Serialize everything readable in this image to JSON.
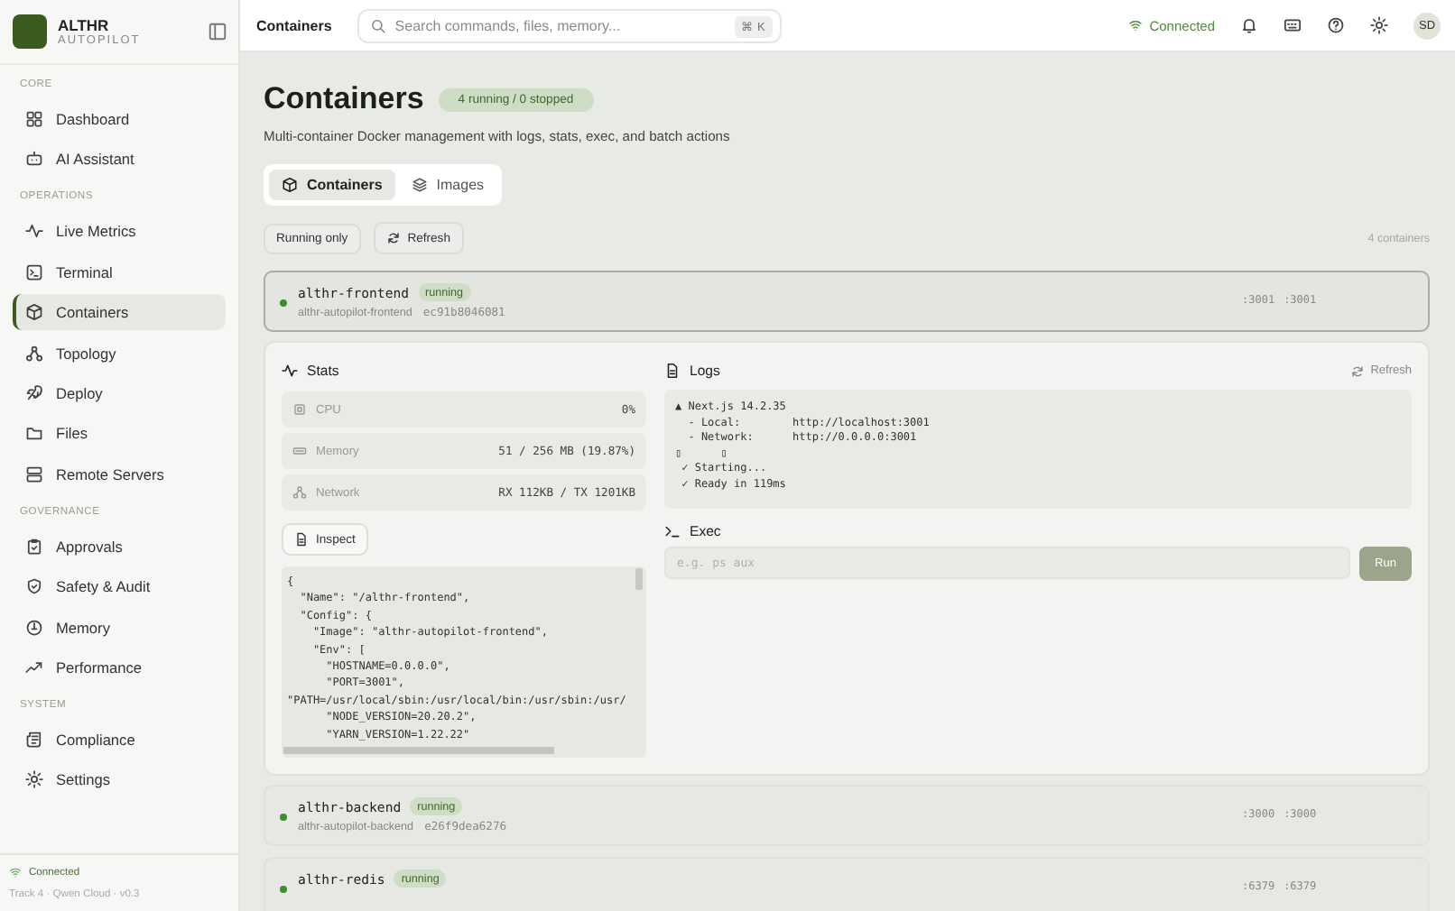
{
  "sidebar": {
    "brand": {
      "name": "ALTHR",
      "subtitle": "AUTOPILOT"
    },
    "sections": [
      {
        "heading": "CORE",
        "items": [
          {
            "label": "Dashboard",
            "selected": false
          },
          {
            "label": "AI Assistant",
            "selected": false
          }
        ]
      },
      {
        "heading": "OPERATIONS",
        "items": [
          {
            "label": "Live Metrics",
            "selected": false
          },
          {
            "label": "Terminal",
            "selected": false
          },
          {
            "label": "Containers",
            "selected": true
          },
          {
            "label": "Topology",
            "selected": false
          },
          {
            "label": "Deploy",
            "selected": false
          },
          {
            "label": "Files",
            "selected": false
          },
          {
            "label": "Remote Servers",
            "selected": false
          }
        ]
      },
      {
        "heading": "GOVERNANCE",
        "items": [
          {
            "label": "Approvals",
            "selected": false
          },
          {
            "label": "Safety & Audit",
            "selected": false
          },
          {
            "label": "Memory",
            "selected": false
          },
          {
            "label": "Performance",
            "selected": false
          }
        ]
      },
      {
        "heading": "SYSTEM",
        "items": [
          {
            "label": "Compliance",
            "selected": false
          },
          {
            "label": "Settings",
            "selected": false
          }
        ]
      }
    ],
    "footer": {
      "status": "Connected",
      "version": "Track 4 · Qwen Cloud · v0.3"
    }
  },
  "topbar": {
    "title": "Containers",
    "search": {
      "placeholder": "Search commands, files, memory...",
      "shortcut": "⌘ K"
    },
    "connection": "Connected",
    "avatar": "SD"
  },
  "page": {
    "title": "Containers",
    "badge": "4 running / 0 stopped",
    "subtitle": "Multi-container Docker management with logs, stats, exec, and batch actions"
  },
  "tabs": [
    {
      "label": "Containers",
      "selected": true
    },
    {
      "label": "Images",
      "selected": false
    }
  ],
  "toolbar": {
    "running_only": "Running only",
    "refresh": "Refresh",
    "count": "4 containers"
  },
  "containers": [
    {
      "name": "althr-frontend",
      "status": "running",
      "image": "althr-autopilot-frontend",
      "id": "ec91b8046081",
      "ports": [
        ":3001",
        ":3001"
      ],
      "selected": true
    },
    {
      "name": "althr-backend",
      "status": "running",
      "image": "althr-autopilot-backend",
      "id": "e26f9dea6276",
      "ports": [
        ":3000",
        ":3000"
      ],
      "selected": false
    },
    {
      "name": "althr-redis",
      "status": "running",
      "ports": [
        ":6379",
        ":6379"
      ],
      "selected": false
    }
  ],
  "details": {
    "stats_title": "Stats",
    "stats": [
      {
        "label": "CPU",
        "value": "0%"
      },
      {
        "label": "Memory",
        "value": "51 / 256 MB (19.87%)"
      },
      {
        "label": "Network",
        "value": "RX 112KB / TX 1201KB"
      }
    ],
    "inspect_button": "Inspect",
    "inspect_lines": [
      "{",
      "  \"Name\": \"/althr-frontend\",",
      "  \"Config\": {",
      "    \"Image\": \"althr-autopilot-frontend\",",
      "    \"Env\": [",
      "      \"HOSTNAME=0.0.0.0\",",
      "      \"PORT=3001\",",
      "\"PATH=/usr/local/sbin:/usr/local/bin:/usr/sbin:/usr/",
      "      \"NODE_VERSION=20.20.2\",",
      "      \"YARN_VERSION=1.22.22\""
    ],
    "logs_title": "Logs",
    "logs_refresh": "Refresh",
    "log_lines": [
      "▲ Next.js 14.2.35",
      "  - Local:        http://localhost:3001",
      "  - Network:      http://0.0.0.0:3001",
      "▯      ▯",
      " ✓ Starting...",
      " ✓ Ready in 119ms"
    ],
    "exec_title": "Exec",
    "exec_placeholder": "e.g. ps aux",
    "run_button": "Run"
  }
}
